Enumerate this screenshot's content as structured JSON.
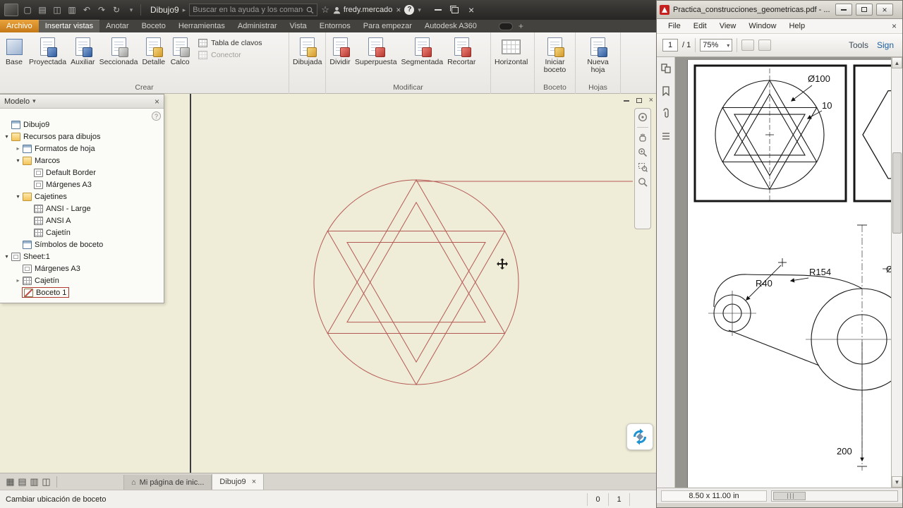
{
  "inventor": {
    "titlebar": {
      "title": "Dibujo9",
      "search_placeholder": "Buscar en la ayuda y los comanc",
      "user": "fredy.mercado"
    },
    "tabs": [
      {
        "label": "Archivo"
      },
      {
        "label": "Insertar vistas"
      },
      {
        "label": "Anotar"
      },
      {
        "label": "Boceto"
      },
      {
        "label": "Herramientas"
      },
      {
        "label": "Administrar"
      },
      {
        "label": "Vista"
      },
      {
        "label": "Entornos"
      },
      {
        "label": "Para empezar"
      },
      {
        "label": "Autodesk A360"
      }
    ],
    "ribbon": {
      "crear": {
        "label": "Crear",
        "base": "Base",
        "proyectada": "Proyectada",
        "auxiliar": "Auxiliar",
        "seccionada": "Seccionada",
        "detalle": "Detalle",
        "calco": "Calco",
        "tabla": "Tabla de clavos",
        "conector": "Conector"
      },
      "dibujada": "Dibujada",
      "modificar": {
        "label": "Modificar",
        "dividir": "Dividir",
        "superpuesta": "Superpuesta",
        "segmentada": "Segmentada",
        "recortar": "Recortar"
      },
      "horizontal": "Horizontal",
      "boceto_group": {
        "label": "Boceto",
        "iniciar": "Iniciar boceto"
      },
      "hojas": {
        "label": "Hojas",
        "nueva": "Nueva hoja"
      }
    },
    "browser": {
      "header": "Modelo",
      "items": [
        {
          "label": "Dibujo9"
        },
        {
          "label": "Recursos para dibujos"
        },
        {
          "label": "Formatos de hoja"
        },
        {
          "label": "Marcos"
        },
        {
          "label": "Default Border"
        },
        {
          "label": "Márgenes A3"
        },
        {
          "label": "Cajetines"
        },
        {
          "label": "ANSI - Large"
        },
        {
          "label": "ANSI A"
        },
        {
          "label": "Cajetín"
        },
        {
          "label": "Símbolos de boceto"
        },
        {
          "label": "Sheet:1"
        },
        {
          "label": "Márgenes A3"
        },
        {
          "label": "Cajetín"
        },
        {
          "label": "Boceto 1"
        }
      ]
    },
    "doc_tabs": {
      "tab1": "Mi página de inic...",
      "tab2": "Dibujo9"
    },
    "statusbar": {
      "message": "Cambiar ubicación de boceto",
      "num1": "0",
      "num2": "1"
    }
  },
  "reader": {
    "title": "Practica_construcciones_geometricas.pdf - ...",
    "menu": {
      "file": "File",
      "edit": "Edit",
      "view": "View",
      "window": "Window",
      "help": "Help"
    },
    "toolbar": {
      "page": "1",
      "of": "/ 1",
      "zoom": "75%",
      "tools": "Tools",
      "sign": "Sign"
    },
    "pdf": {
      "d1": "Ø100",
      "d2": "10",
      "d3": "R154",
      "d4": "R40",
      "d5": "200",
      "d6": "Ø"
    },
    "statusbar": {
      "size": "8.50 x 11.00 in"
    }
  },
  "colors": {
    "sketch_red": "#b45a54",
    "canvas_cream": "#efecd7",
    "archivo_orange": "#d98f2c"
  }
}
